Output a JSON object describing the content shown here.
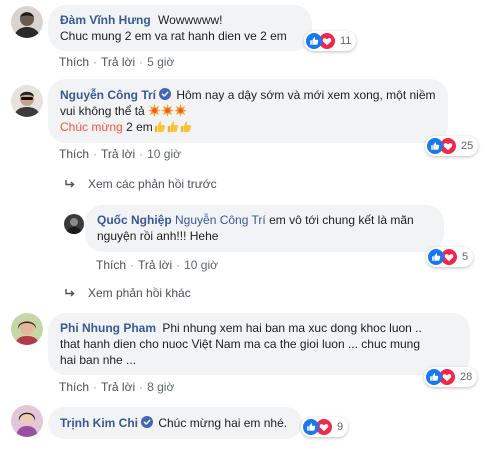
{
  "comments": [
    {
      "name": "Đàm Vĩnh Hưng",
      "verified": false,
      "line1": "Wowwwww!",
      "line2": "Chuc mung 2 em va rat hanh dien ve 2 em",
      "like": "Thích",
      "reply": "Trả lời",
      "time": "5 giờ",
      "reactions": "11"
    },
    {
      "name": "Nguyễn Công Trí",
      "verified": true,
      "line1": "Hôm nay a dậy sớm và mới xem xong, một niềm",
      "line2": "vui không thể tả",
      "line3_highlight": "Chúc mừng",
      "line3_rest": " 2 em",
      "like": "Thích",
      "reply": "Trả lời",
      "time": "10 giờ",
      "reactions": "25"
    },
    {
      "name": "Quốc Nghiệp",
      "tag": "Nguyễn Công Trí",
      "line1": "em vô tới chung kết là mãn",
      "line2": "nguyện rồi anh!!! Hehe",
      "like": "Thích",
      "reply": "Trả lời",
      "time": "10 giờ",
      "reactions": "5"
    },
    {
      "name": "Phi Nhung Pham",
      "line1": "Phi nhung xem hai ban ma xuc dong khoc luon ..",
      "line2": "that hanh dien cho nuoc Việt Nam ma ca the gioi luon ... chuc mung",
      "line3": "hai ban nhe ...",
      "like": "Thích",
      "reply": "Trả lời",
      "time": "8 giờ",
      "reactions": "28"
    },
    {
      "name": "Trịnh Kim Chi",
      "verified": true,
      "line1": "Chúc mừng hai em nhé.",
      "reactions": "9"
    }
  ],
  "replies_prev": "Xem các phản hồi trước",
  "replies_more": "Xem phản hồi khác",
  "colors": {
    "name": "#385898",
    "bubble": "#f2f3f5",
    "meta": "#606770",
    "like_blue": "#1877f2",
    "love_red": "#f0284a",
    "highlight": "#f5533d"
  },
  "icons": [
    "like-reaction-icon",
    "love-reaction-icon",
    "verified-badge-icon",
    "reply-arrow-icon",
    "sparkle-emoji",
    "thumbs-up-emoji"
  ]
}
